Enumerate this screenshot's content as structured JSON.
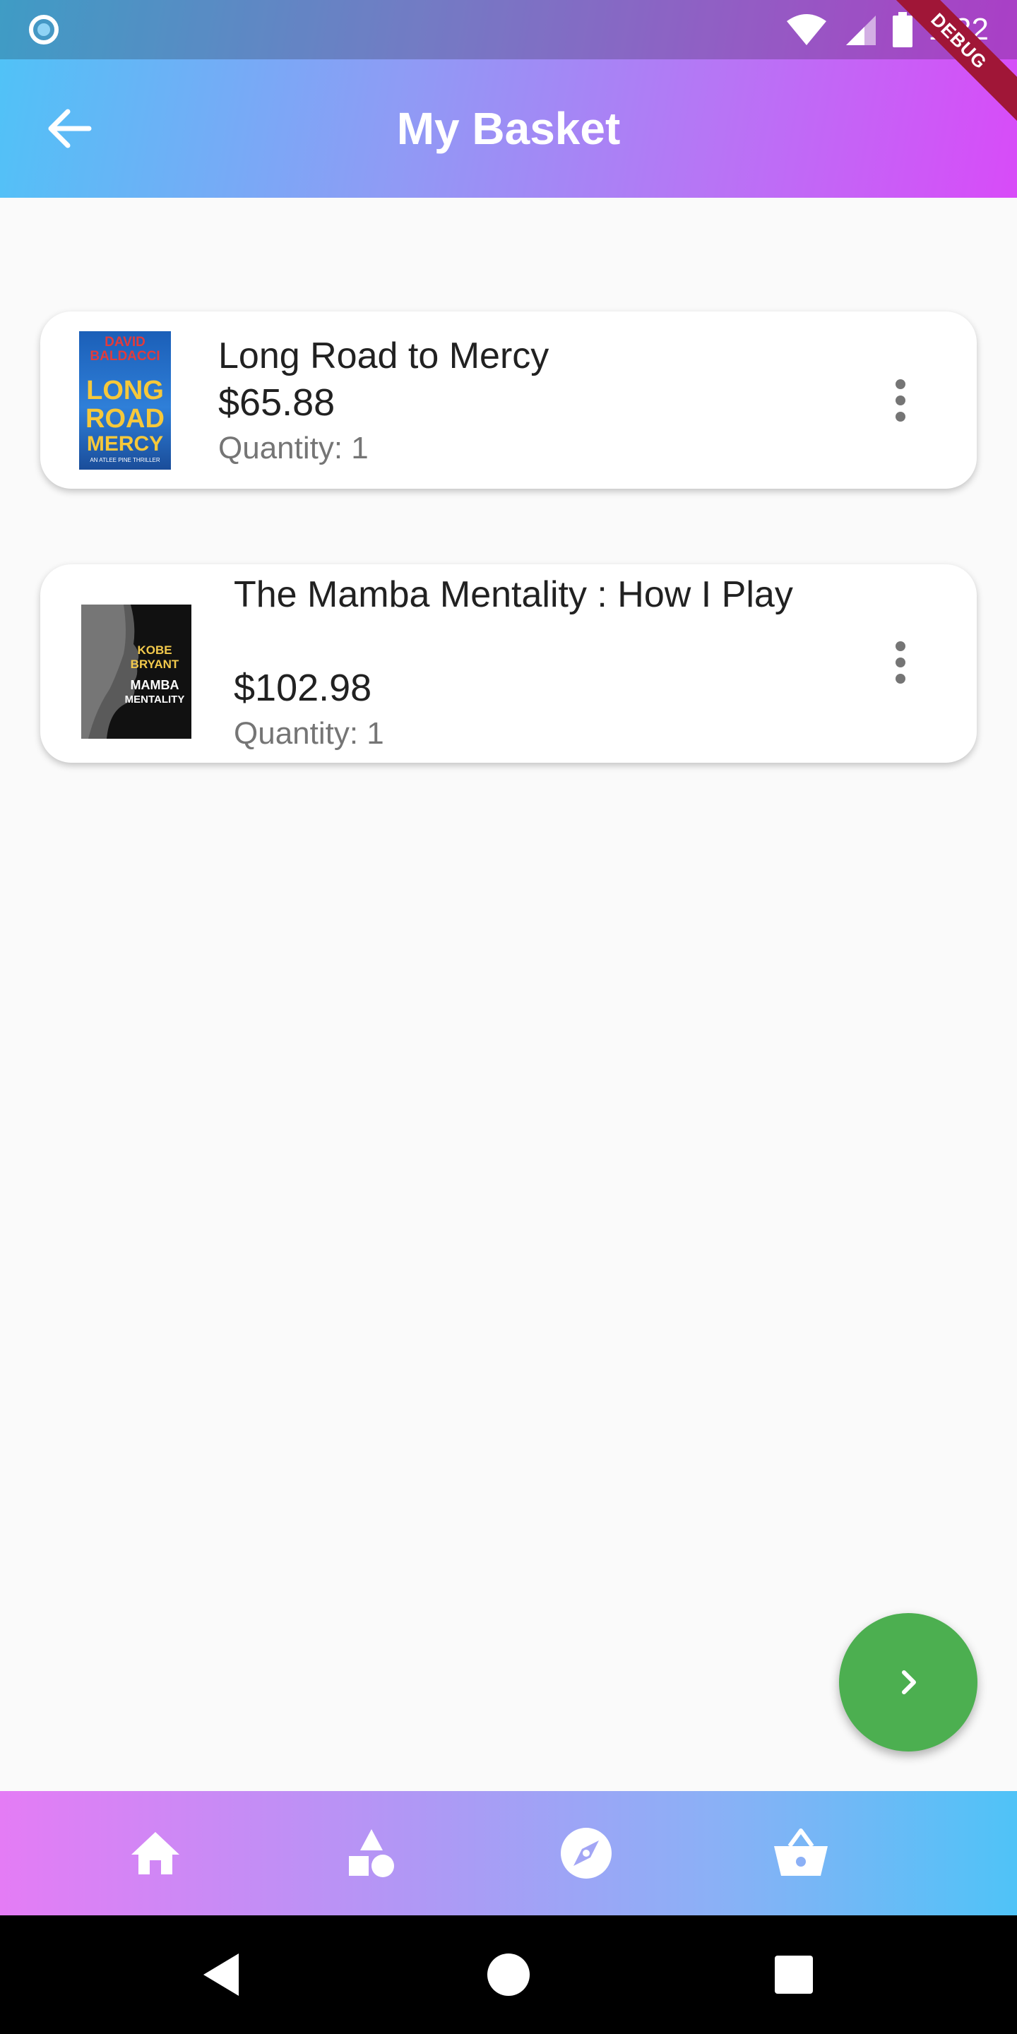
{
  "status_bar": {
    "time": "1:32",
    "left_icon": "circle-notification-icon",
    "right_icons": [
      "wifi-icon",
      "signal-icon",
      "battery-icon"
    ],
    "debug_banner": "DEBUG"
  },
  "app_bar": {
    "title": "My Basket",
    "back_icon": "arrow-back-icon"
  },
  "basket_items": [
    {
      "title": "Long Road to Mercy",
      "price": "$65.88",
      "quantity": "Quantity: 1",
      "cover": {
        "author": "DAVID BALDACCI",
        "title_words": [
          "LONG",
          "ROAD",
          "MERCY"
        ],
        "tagline": "AN ATLEE PINE THRILLER"
      },
      "menu_icon": "more-vert-icon"
    },
    {
      "title": "The Mamba Mentality : How I Play",
      "price": "$102.98",
      "quantity": "Quantity: 1",
      "cover": {
        "author_words": [
          "KOBE",
          "BRYANT"
        ],
        "title_words": [
          "MAMBA",
          "MENTALITY"
        ]
      },
      "menu_icon": "more-vert-icon"
    }
  ],
  "fab": {
    "icon": "chevron-right-icon"
  },
  "bottom_nav": {
    "items": [
      {
        "icon": "home-icon"
      },
      {
        "icon": "categories-icon"
      },
      {
        "icon": "explore-icon"
      },
      {
        "icon": "basket-icon"
      }
    ]
  },
  "system_nav": {
    "items": [
      {
        "icon": "back-triangle-icon"
      },
      {
        "icon": "home-circle-icon"
      },
      {
        "icon": "recents-square-icon"
      }
    ]
  },
  "colors": {
    "gradient_start": "#4fc3f7",
    "gradient_end": "#d84bf8",
    "fab": "#4caf50",
    "debug_ribbon": "#a01637",
    "background": "#fafafa"
  }
}
